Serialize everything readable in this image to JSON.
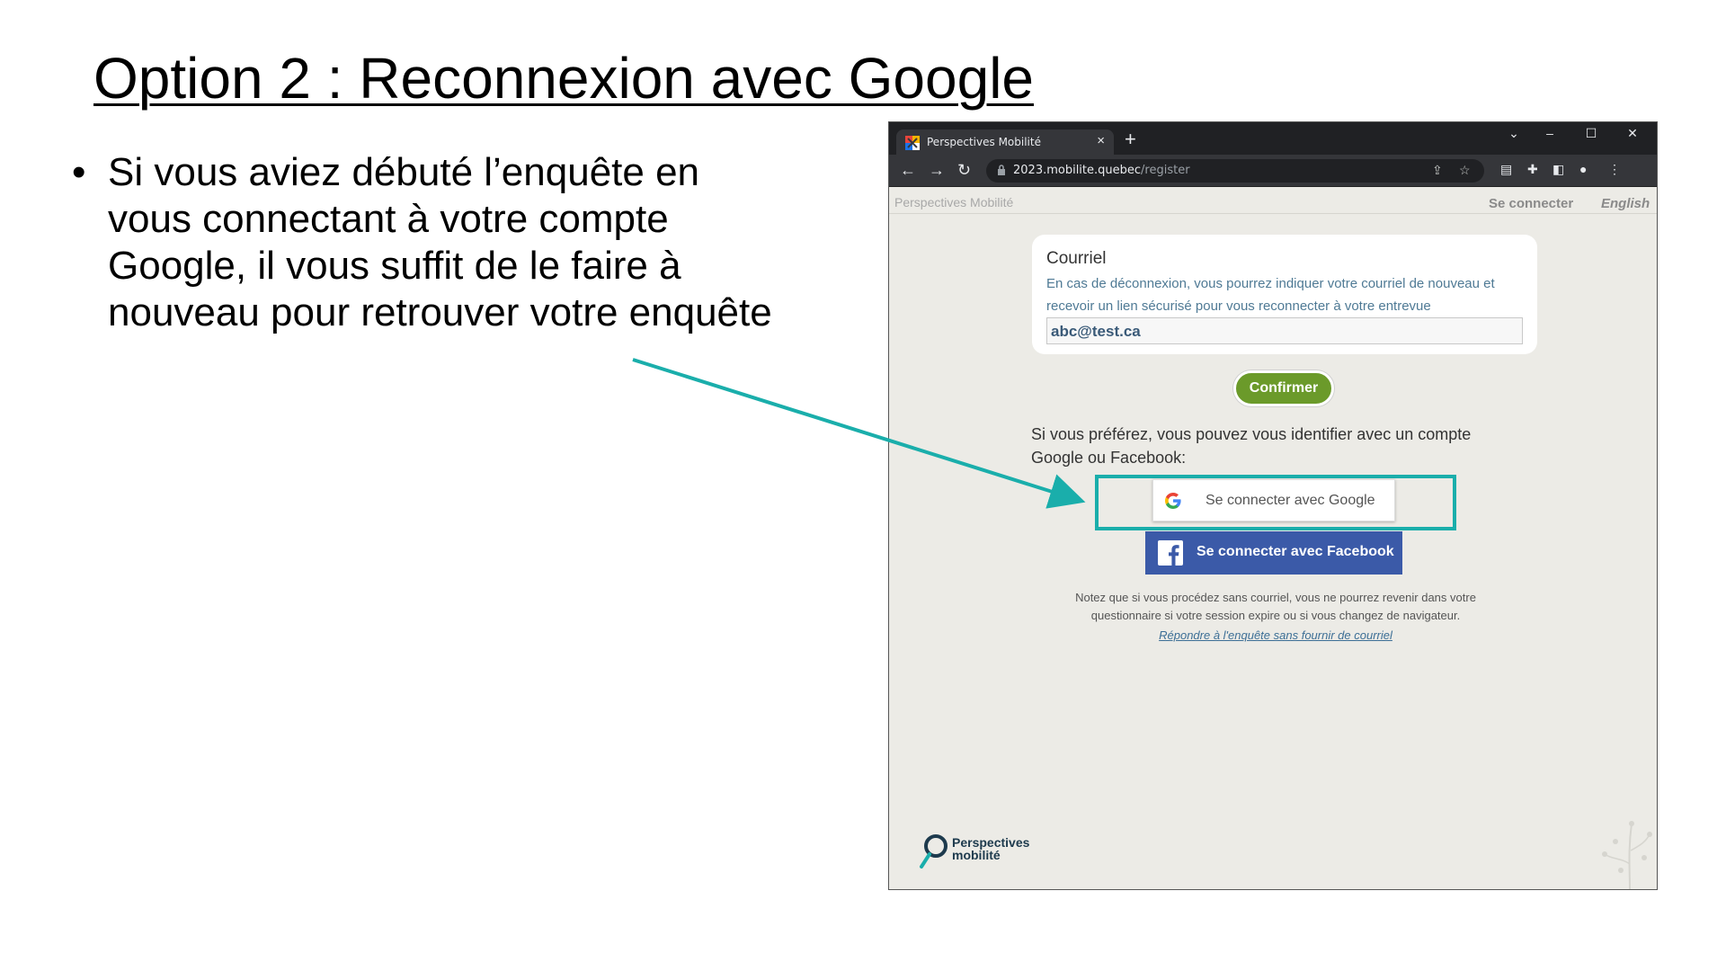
{
  "slide": {
    "title": "Option 2 : Reconnexion avec Google",
    "bullet": "Si vous aviez débuté l’enquête en vous connectant à votre compte Google, il vous suffit de le faire à nouveau pour retrouver votre enquête"
  },
  "browser": {
    "tab_title": "Perspectives Mobilité",
    "tab_close": "×",
    "new_tab": "+",
    "url_host": "2023.mobilite.quebec",
    "url_path": "/register",
    "window_controls": {
      "chevron": "⌄",
      "minimize": "–",
      "maximize": "☐",
      "close": "✕"
    }
  },
  "site": {
    "brand": "Perspectives Mobilité",
    "login": "Se connecter",
    "language": "English",
    "email_label": "Courriel",
    "email_help": "En cas de déconnexion, vous pourrez indiquer votre courriel de nouveau et recevoir un lien sécurisé pour vous reconnecter à votre entrevue",
    "email_value": "abc@test.ca",
    "confirm": "Confirmer",
    "alt_text": "Si vous préférez, vous pouvez vous identifier avec un compte Google ou Facebook:",
    "google_button": "Se connecter avec Google",
    "facebook_button": "Se connecter avec Facebook",
    "note": "Notez que si vous procédez sans courriel, vous ne pourrez revenir dans votre questionnaire si votre session expire ou si vous changez de navigateur.",
    "skip_link": "Répondre à l'enquête sans fournir de courriel",
    "footer_logo_line1": "Perspectives",
    "footer_logo_line2": "mobilité"
  },
  "colors": {
    "highlight": "#1aaeab",
    "confirm_green": "#6b9a2a",
    "facebook_blue": "#3b5aa8"
  },
  "icons": [
    "favicon-icon",
    "back-icon",
    "forward-icon",
    "reload-icon",
    "lock-icon",
    "share-icon",
    "star-icon",
    "reading-list-icon",
    "extensions-icon",
    "side-panel-icon",
    "profile-icon",
    "menu-icon",
    "google-icon",
    "facebook-icon",
    "arrow-icon"
  ]
}
